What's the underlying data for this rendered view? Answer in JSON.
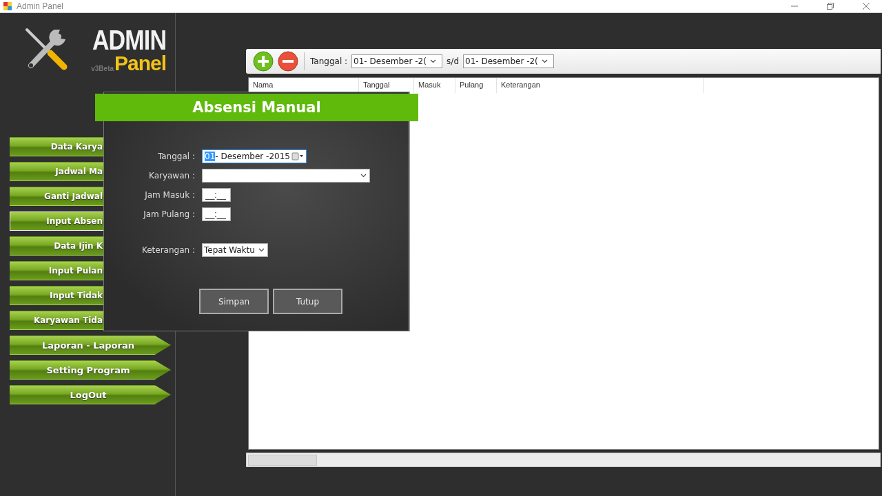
{
  "window": {
    "title": "Admin Panel"
  },
  "logo": {
    "title": "ADMIN",
    "version": "v3Beta",
    "subtitle": "Panel"
  },
  "sidebar": {
    "items": [
      {
        "label": "Data Karya",
        "kind": "plain",
        "selected": false
      },
      {
        "label": "Jadwal Ma",
        "kind": "plain",
        "selected": false
      },
      {
        "label": "Ganti Jadwal",
        "kind": "plain",
        "selected": false
      },
      {
        "label": "Input Absen",
        "kind": "plain",
        "selected": true
      },
      {
        "label": "Data Ijin K",
        "kind": "plain",
        "selected": false
      },
      {
        "label": "Input Pulan",
        "kind": "plain",
        "selected": false
      },
      {
        "label": "Input Tidak",
        "kind": "plain",
        "selected": false
      },
      {
        "label": "Karyawan Tida",
        "kind": "plain",
        "selected": false
      },
      {
        "label": "Laporan - Laporan",
        "kind": "arrow",
        "selected": false
      },
      {
        "label": "Setting Program",
        "kind": "arrow",
        "selected": false
      },
      {
        "label": "LogOut",
        "kind": "arrow",
        "selected": false
      }
    ]
  },
  "toolbar": {
    "date_label": "Tanggal :",
    "date_from": "01- Desember -2(",
    "separator": "s/d",
    "date_to": "01- Desember -2("
  },
  "table": {
    "columns": [
      "Nama",
      "Tanggal",
      "Masuk",
      "Pulang",
      "Keterangan"
    ]
  },
  "dialog": {
    "title": "Absensi Manual",
    "fields": [
      {
        "kind": "date",
        "label": "Tanggal :",
        "selected_text": "01",
        "value": "- Desember -2015"
      },
      {
        "kind": "combo",
        "label": "Karyawan :"
      },
      {
        "kind": "time",
        "label": "Jam Masuk :",
        "value": "__:__"
      },
      {
        "kind": "time",
        "label": "Jam Pulang :",
        "value": "__:__"
      },
      {
        "kind": "combo_small",
        "label": "Keterangan :",
        "value": "Tepat Waktu"
      }
    ],
    "buttons": [
      "Simpan",
      "Tutup"
    ]
  }
}
